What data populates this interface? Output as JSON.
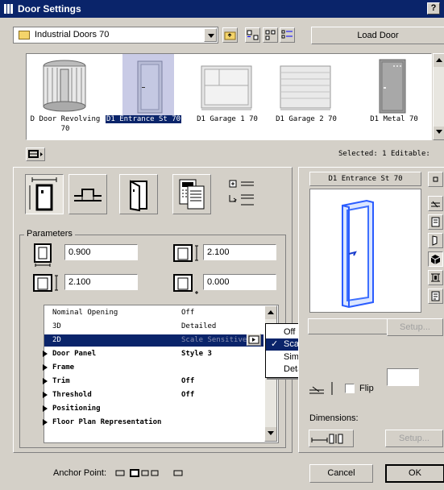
{
  "window": {
    "title": "Door Settings",
    "help": "?"
  },
  "library": {
    "folder": "Industrial Doors 70",
    "load_button": "Load Door"
  },
  "thumbnails": [
    {
      "label": "D Door Revolving 70",
      "selected": false
    },
    {
      "label": "D1 Entrance St 70",
      "selected": true
    },
    {
      "label": "D1 Garage 1 70",
      "selected": false
    },
    {
      "label": "D1 Garage 2 70",
      "selected": false
    },
    {
      "label": "D1 Metal 70",
      "selected": false
    }
  ],
  "status": {
    "selected": "Selected: 1 Editable:"
  },
  "parameters": {
    "legend": "Parameters",
    "width": "0.900",
    "height": "2.100",
    "sill_height": "2.100",
    "offset": "0.000"
  },
  "param_list": [
    {
      "name": "Nominal Opening",
      "value": "Off",
      "bold": false,
      "expandable": false
    },
    {
      "name": "3D",
      "value": "Detailed",
      "bold": false,
      "expandable": false
    },
    {
      "name": "2D",
      "value": "Scale Sensitive",
      "bold": false,
      "expandable": false,
      "selected": true
    },
    {
      "name": "Door Panel",
      "value": "Style 3",
      "bold": true,
      "expandable": true
    },
    {
      "name": "Frame",
      "value": "",
      "bold": true,
      "expandable": true
    },
    {
      "name": "Trim",
      "value": "Off",
      "bold": true,
      "expandable": true
    },
    {
      "name": "Threshold",
      "value": "Off",
      "bold": true,
      "expandable": true
    },
    {
      "name": "Positioning",
      "value": "",
      "bold": true,
      "expandable": true
    },
    {
      "name": "Floor Plan Representation",
      "value": "",
      "bold": true,
      "expandable": true
    }
  ],
  "popup_options": [
    "Off",
    "Scale Sensitive",
    "Simple",
    "Detailed"
  ],
  "popup_selected": "Scale Sensitive",
  "preview": {
    "title": "D1 Entrance St 70"
  },
  "right": {
    "setup1": "Setup...",
    "flip": "Flip",
    "dimensions": "Dimensions:",
    "setup2": "Setup..."
  },
  "footer": {
    "anchor_label": "Anchor Point:",
    "cancel": "Cancel",
    "ok": "OK"
  }
}
